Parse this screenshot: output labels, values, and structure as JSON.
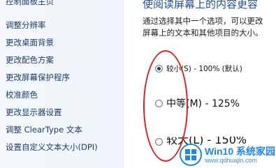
{
  "sidebar": {
    "items": [
      {
        "label": "控制面板主页"
      },
      {
        "label": "调整分辨率"
      },
      {
        "label": "更改桌面背景"
      },
      {
        "label": "更改配色方案"
      },
      {
        "label": "更改屏幕保护程序"
      },
      {
        "label": "校准颜色"
      },
      {
        "label": "更改显示器设置"
      },
      {
        "label": "调整 ClearType 文本"
      },
      {
        "label": "设置自定义文本大小(DPI)"
      }
    ]
  },
  "main": {
    "heading": "使阅读屏幕上的内容更容",
    "description": "通过选择其中一个选项，可以更改屏幕上的文本和其他项目的大小。",
    "options": [
      {
        "label": "较小(S) - 100% (默认)",
        "checked": true
      },
      {
        "label": "中等(M) - 125%",
        "checked": false
      },
      {
        "label": "较大(L) - 150%",
        "checked": false
      }
    ]
  },
  "watermark": {
    "brand": "Win10 系统家园",
    "url": "www.qdhuajin.com"
  },
  "colors": {
    "heading": "#1f4e8c",
    "annotation": "#d9231d",
    "watermark": "#1e88e5"
  }
}
